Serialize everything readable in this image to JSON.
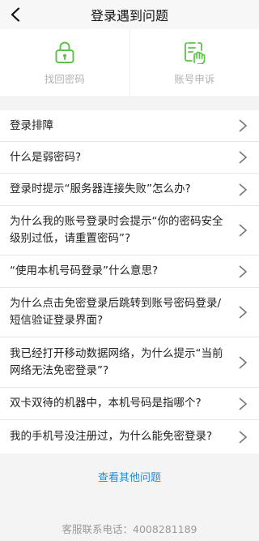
{
  "header": {
    "title": "登录遇到问题"
  },
  "shortcuts": [
    {
      "label": "找回密码",
      "icon": "lock-icon"
    },
    {
      "label": "账号申诉",
      "icon": "appeal-icon"
    }
  ],
  "faq": [
    "登录排障",
    "什么是弱密码?",
    "登录时提示“服务器连接失败”怎么办?",
    "为什么我的账号登录时会提示“你的密码安全级别过低，请重置密码”?",
    "“使用本机号码登录”什么意思?",
    "为什么点击免密登录后跳转到账号密码登录/短信验证登录界面?",
    "我已经打开移动数据网络，为什么提示“当前网络无法免密登录”?",
    "双卡双待的机器中，本机号码是指哪个?",
    "我的手机号没注册过，为什么能免密登录?"
  ],
  "more_link": "查看其他问题",
  "service_phone": "客服联系电话：4008281189",
  "colors": {
    "accent_green": "#5cc24a",
    "link_blue": "#1a8fe0"
  }
}
